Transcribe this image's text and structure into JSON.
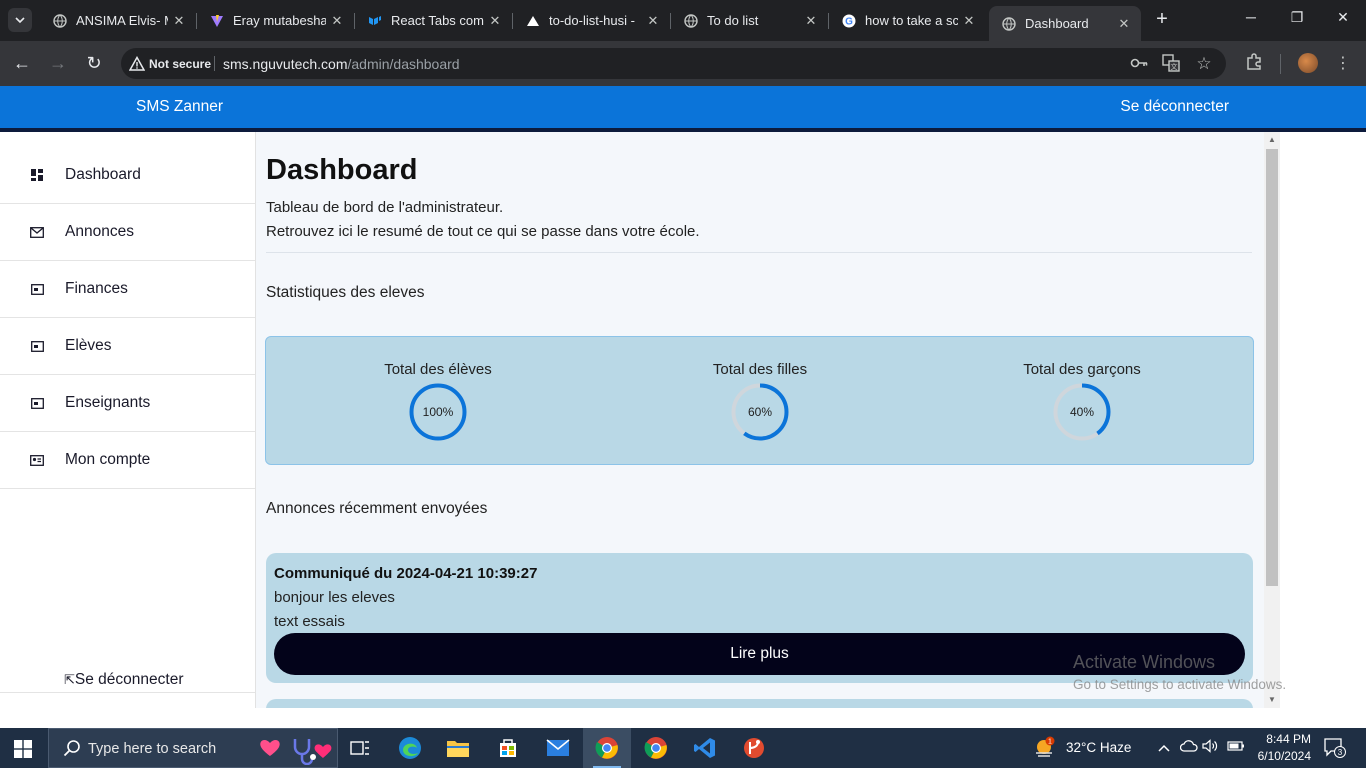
{
  "browser": {
    "tabs": [
      {
        "title": "ANSIMA Elvis- M",
        "icon": "globe-icon",
        "active": false
      },
      {
        "title": "Eray mutabesha",
        "icon": "vite-icon",
        "active": false
      },
      {
        "title": "React Tabs comp",
        "icon": "mui-icon",
        "active": false
      },
      {
        "title": "to-do-list-husi -",
        "icon": "vercel-icon",
        "active": false
      },
      {
        "title": "To do list",
        "icon": "globe-icon",
        "active": false
      },
      {
        "title": "how to take a sc",
        "icon": "google-icon",
        "active": false
      },
      {
        "title": "Dashboard",
        "icon": "globe-icon",
        "active": true
      }
    ],
    "security_label": "Not secure",
    "url_domain": "sms.nguvutech.com",
    "url_path": "/admin/dashboard"
  },
  "app": {
    "brand": "SMS Zanner",
    "logout_label": "Se déconnecter"
  },
  "sidebar": {
    "items": [
      {
        "label": "Dashboard",
        "icon": "dashboard-icon"
      },
      {
        "label": "Annonces",
        "icon": "envelope-icon"
      },
      {
        "label": "Finances",
        "icon": "card-icon"
      },
      {
        "label": "Elèves",
        "icon": "card-icon"
      },
      {
        "label": "Enseignants",
        "icon": "card-icon"
      },
      {
        "label": "Mon compte",
        "icon": "id-card-icon"
      }
    ],
    "logout_label": "Se déconnecter"
  },
  "main": {
    "title": "Dashboard",
    "subtitle_1": "Tableau de bord de l'administrateur.",
    "subtitle_2": "Retrouvez ici le resumé de tout ce qui se passe dans votre école.",
    "stats_heading": "Statistiques des eleves",
    "stats": [
      {
        "label": "Total des élèves",
        "value_text": "100%",
        "fraction": 1.0
      },
      {
        "label": "Total des filles",
        "value_text": "60%",
        "fraction": 0.6
      },
      {
        "label": "Total des garçons",
        "value_text": "40%",
        "fraction": 0.4
      }
    ],
    "announcements_heading": "Annonces récemment envoyées",
    "announcements": [
      {
        "title": "Communiqué du 2024-04-21 10:39:27",
        "line_1": "bonjour les eleves",
        "line_2": "text essais",
        "button_label": "Lire plus"
      }
    ]
  },
  "watermark": {
    "line_1": "Activate Windows",
    "line_2": "Go to Settings to activate Windows."
  },
  "taskbar": {
    "search_placeholder": "Type here to search",
    "weather": "32°C  Haze",
    "weather_badge": "1",
    "time": "8:44 PM",
    "date": "6/10/2024",
    "notification_count": "3"
  },
  "colors": {
    "appbar": "#0b74d9",
    "ring_progress": "#0b74d9",
    "ring_track": "#cfd6dc",
    "card_bg": "#b9d8e6",
    "button_bg": "#03031a"
  }
}
